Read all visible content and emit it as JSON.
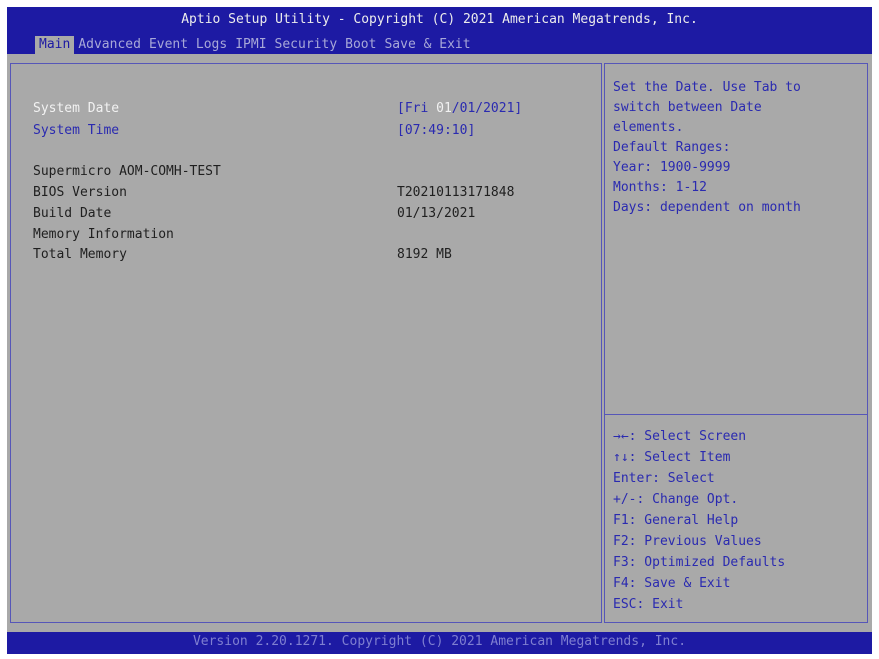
{
  "header": {
    "title": "Aptio Setup Utility - Copyright (C) 2021 American Megatrends, Inc."
  },
  "menu": {
    "tabs": [
      {
        "label": "Main"
      },
      {
        "label": "Advanced"
      },
      {
        "label": "Event Logs"
      },
      {
        "label": "IPMI"
      },
      {
        "label": "Security"
      },
      {
        "label": "Boot"
      },
      {
        "label": "Save & Exit"
      }
    ]
  },
  "main": {
    "system_date": {
      "label": "System Date",
      "value_prefix": "[Fri ",
      "value_selected": "01",
      "value_suffix": "/01/2021]"
    },
    "system_time": {
      "label": "System Time",
      "value": "[07:49:10]"
    },
    "product": {
      "label": "Supermicro AOM-COMH-TEST"
    },
    "bios_version": {
      "label": "BIOS Version",
      "value": "T20210113171848"
    },
    "build_date": {
      "label": "Build Date",
      "value": "01/13/2021"
    },
    "memory_info": {
      "label": "Memory Information"
    },
    "total_memory": {
      "label": "Total Memory",
      "value": "8192 MB"
    }
  },
  "help": {
    "description": [
      "Set the Date. Use Tab to",
      "switch between Date",
      "elements.",
      "Default Ranges:",
      "Year: 1900-9999",
      "Months: 1-12",
      "Days: dependent on month"
    ],
    "keys": [
      "→←: Select Screen",
      "↑↓: Select Item",
      "Enter: Select",
      "+/-: Change Opt.",
      "F1: General Help",
      "F2: Previous Values",
      "F3: Optimized Defaults",
      "F4: Save & Exit",
      "ESC: Exit"
    ]
  },
  "footer": {
    "text": "Version 2.20.1271. Copyright (C) 2021 American Megatrends, Inc."
  },
  "colors": {
    "header_bg": "#1d1aa3",
    "screen_bg": "#a9a9a9",
    "text_blue": "#2a2ab0",
    "text_dark": "#1f1f1f",
    "text_white": "#f2f2f2"
  }
}
